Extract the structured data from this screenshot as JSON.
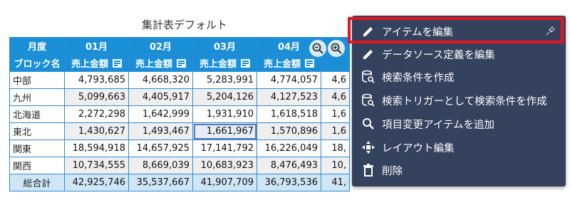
{
  "title": "集計表デフォルト",
  "table": {
    "header_corner": "月度",
    "months": [
      "01月",
      "02月",
      "03月",
      "04月"
    ],
    "partial_month": "0",
    "row_header": "ブロック名",
    "measure": "売上金額",
    "rows": [
      {
        "label": "中部",
        "values": [
          "4,793,685",
          "4,668,320",
          "5,283,991",
          "4,774,057"
        ],
        "partial": "4,6"
      },
      {
        "label": "九州",
        "values": [
          "5,099,663",
          "4,405,917",
          "5,204,126",
          "4,127,523"
        ],
        "partial": "4,6"
      },
      {
        "label": "北海道",
        "values": [
          "2,272,298",
          "1,642,999",
          "1,931,910",
          "1,618,518"
        ],
        "partial": "1,6"
      },
      {
        "label": "東北",
        "values": [
          "1,430,627",
          "1,493,467",
          "1,661,967",
          "1,570,896"
        ],
        "partial": "1,6"
      },
      {
        "label": "関東",
        "values": [
          "18,594,918",
          "14,657,925",
          "17,141,792",
          "16,226,049"
        ],
        "partial": "18,"
      },
      {
        "label": "関西",
        "values": [
          "10,734,555",
          "8,669,039",
          "10,683,923",
          "8,476,493"
        ],
        "partial": "10,"
      }
    ],
    "total": {
      "label": "総合計",
      "values": [
        "42,925,746",
        "35,537,667",
        "41,907,709",
        "36,793,536"
      ],
      "partial": "41,"
    }
  },
  "menu": {
    "items": [
      {
        "label": "アイテムを編集",
        "icon": "pencil-icon"
      },
      {
        "label": "データソース定義を編集",
        "icon": "pencil-icon"
      },
      {
        "label": "検索条件を作成",
        "icon": "database-search-icon"
      },
      {
        "label": "検索トリガーとして検索条件を作成",
        "icon": "database-search-icon"
      },
      {
        "label": "項目変更アイテムを追加",
        "icon": "search-icon"
      },
      {
        "label": "レイアウト編集",
        "icon": "move-icon"
      },
      {
        "label": "削除",
        "icon": "trash-icon"
      }
    ]
  },
  "colors": {
    "header": "#1a8fd8",
    "menu_bg": "#34425e",
    "highlight": "#e8141f"
  }
}
